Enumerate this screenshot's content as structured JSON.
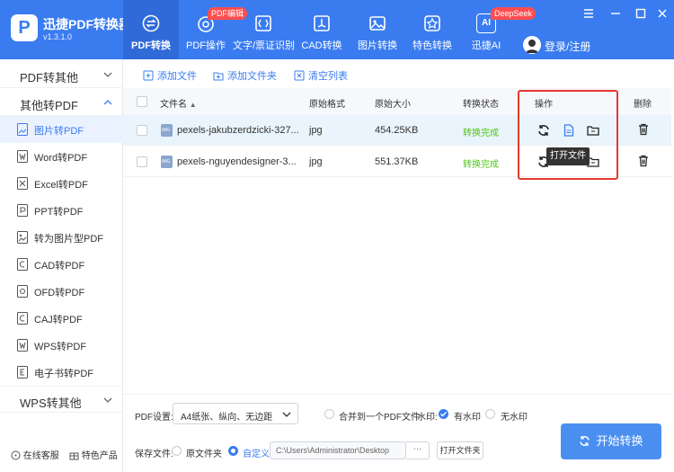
{
  "app": {
    "title": "迅捷PDF转换器",
    "version": "v1.3.1.0",
    "logo_letter": "P"
  },
  "nav": [
    {
      "label": "PDF转换",
      "icon": "convert-icon",
      "active": true
    },
    {
      "label": "PDF操作",
      "icon": "pdf-edit-icon",
      "badge": "PDF编辑"
    },
    {
      "label": "文字/票证识别",
      "icon": "ocr-icon"
    },
    {
      "label": "CAD转换",
      "icon": "cad-icon"
    },
    {
      "label": "图片转换",
      "icon": "image-icon"
    },
    {
      "label": "特色转换",
      "icon": "star-icon"
    },
    {
      "label": "迅捷AI",
      "icon": "ai-icon",
      "badge": "DeepSeek",
      "icon_text": "AI"
    }
  ],
  "user": {
    "login_label": "登录/注册"
  },
  "sidebar": {
    "group1": "PDF转其他",
    "group2": "其他转PDF",
    "group3": "WPS转其他",
    "items": [
      {
        "label": "图片转PDF",
        "active": true
      },
      {
        "label": "Word转PDF"
      },
      {
        "label": "Excel转PDF"
      },
      {
        "label": "PPT转PDF"
      },
      {
        "label": "转为图片型PDF"
      },
      {
        "label": "CAD转PDF"
      },
      {
        "label": "OFD转PDF"
      },
      {
        "label": "CAJ转PDF"
      },
      {
        "label": "WPS转PDF"
      },
      {
        "label": "电子书转PDF"
      }
    ],
    "online_service": "在线客服",
    "featured_products": "特色产品"
  },
  "toolbar": {
    "add_file": "添加文件",
    "add_folder": "添加文件夹",
    "clear_list": "清空列表"
  },
  "table": {
    "headers": {
      "name": "文件名",
      "format": "原始格式",
      "size": "原始大小",
      "status": "转换状态",
      "ops": "操作",
      "delete": "删除"
    },
    "rows": [
      {
        "name": "pexels-jakubzerdzicki-327...",
        "format": "jpg",
        "size": "454.25KB",
        "status": "转换完成",
        "icon_text": "IMG"
      },
      {
        "name": "pexels-nguyendesigner-3...",
        "format": "jpg",
        "size": "551.37KB",
        "status": "转换完成",
        "icon_text": "IMG"
      }
    ]
  },
  "tooltip": "打开文件",
  "footer": {
    "pdf_settings_label": "PDF设置:",
    "pdf_settings_value": "A4纸张、纵向、无边距",
    "merge_label": "合并到一个PDF文件",
    "watermark_label": "水印:",
    "with_watermark": "有水印",
    "no_watermark": "无水印",
    "save_label": "保存文件:",
    "original_folder": "原文件夹",
    "custom": "自定义",
    "path": "C:\\Users\\Administrator\\Desktop",
    "dots": "···",
    "open_folder": "打开文件夹",
    "start": "开始转换"
  },
  "colors": {
    "primary": "#3a7cf0",
    "success": "#52c41a",
    "badge": "#ff4d4f",
    "highlight": "#e53935"
  }
}
